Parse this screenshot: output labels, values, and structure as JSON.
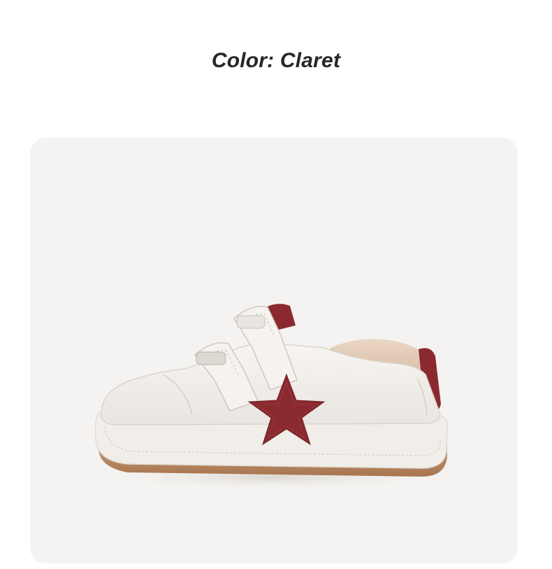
{
  "header": {
    "color_text": "Color: Claret"
  },
  "product": {
    "accent_color": "#8a2a2f",
    "upper_color": "#f2eeea",
    "sole_color": "#b8865e",
    "card_background": "#f4f3f1"
  }
}
